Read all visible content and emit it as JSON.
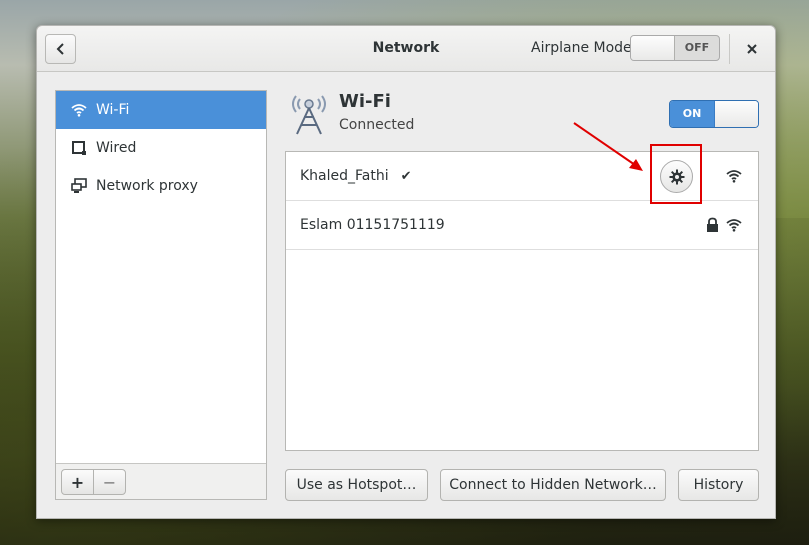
{
  "window": {
    "title": "Network",
    "airplane_mode_label": "Airplane Mode",
    "airplane_toggle_state": "OFF"
  },
  "sidebar": {
    "items": [
      {
        "label": "Wi-Fi",
        "icon": "wifi-icon",
        "active": true
      },
      {
        "label": "Wired",
        "icon": "wired-icon",
        "active": false
      },
      {
        "label": "Network proxy",
        "icon": "network-proxy-icon",
        "active": false
      }
    ],
    "add_label": "+",
    "remove_label": "−"
  },
  "wifi": {
    "title": "Wi-Fi",
    "status": "Connected",
    "toggle_state": "ON"
  },
  "networks": [
    {
      "ssid": "Khaled_Fathi",
      "connected_mark": "✔",
      "secured": false,
      "connected": true
    },
    {
      "ssid": "Eslam 01151751119",
      "connected_mark": "",
      "secured": true,
      "connected": false
    }
  ],
  "actions": {
    "hotspot_label": "Use as Hotspot…",
    "hidden_network_label": "Connect to Hidden Network…",
    "history_label": "History"
  },
  "colors": {
    "accent": "#4a90d9",
    "annotation": "#e00000"
  }
}
